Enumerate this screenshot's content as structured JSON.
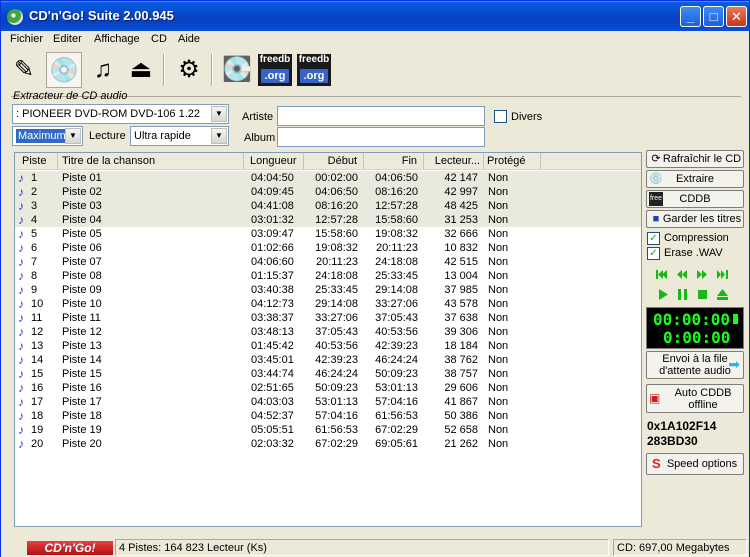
{
  "window": {
    "title": "CD'n'Go! Suite 2.00.945",
    "minimize": "_",
    "maximize": "□",
    "close": "✕"
  },
  "menu": [
    "Fichier",
    "Editer",
    "Affichage",
    "CD",
    "Aide"
  ],
  "toolbar": {
    "tools": [
      "edit-tool-icon",
      "cd-ripper-icon",
      "music-keyboard-icon",
      "cd-tray-icon",
      "settings-gear-icon",
      "cd-burner-icon"
    ],
    "freedb_top": "freedb",
    "freedb_bottom": ".org"
  },
  "extractor": {
    "group_label": "Extracteur de CD audio",
    "drive": ":  PIONEER DVD-ROM DVD-106 1.22",
    "quality": "Maximum",
    "lecture_label": "Lecture",
    "lecture_value": "Ultra rapide",
    "artist_label": "Artiste",
    "artist_value": "",
    "album_label": "Album",
    "album_value": "",
    "divers_label": "Divers"
  },
  "tracklist": {
    "columns": [
      "Piste",
      "Titre de la chanson",
      "Longueur",
      "Début",
      "Fin",
      "Lecteur...",
      "Protégé"
    ],
    "rows": [
      {
        "n": "1",
        "title": "Piste 01",
        "len": "04:04:50",
        "start": "00:02:00",
        "end": "04:06:50",
        "size": "42 147",
        "prot": "Non",
        "selected": true
      },
      {
        "n": "2",
        "title": "Piste 02",
        "len": "04:09:45",
        "start": "04:06:50",
        "end": "08:16:20",
        "size": "42 997",
        "prot": "Non",
        "selected": true
      },
      {
        "n": "3",
        "title": "Piste 03",
        "len": "04:41:08",
        "start": "08:16:20",
        "end": "12:57:28",
        "size": "48 425",
        "prot": "Non",
        "selected": true
      },
      {
        "n": "4",
        "title": "Piste 04",
        "len": "03:01:32",
        "start": "12:57:28",
        "end": "15:58:60",
        "size": "31 253",
        "prot": "Non",
        "selected": true
      },
      {
        "n": "5",
        "title": "Piste 05",
        "len": "03:09:47",
        "start": "15:58:60",
        "end": "19:08:32",
        "size": "32 666",
        "prot": "Non",
        "selected": false
      },
      {
        "n": "6",
        "title": "Piste 06",
        "len": "01:02:66",
        "start": "19:08:32",
        "end": "20:11:23",
        "size": "10 832",
        "prot": "Non",
        "selected": false
      },
      {
        "n": "7",
        "title": "Piste 07",
        "len": "04:06:60",
        "start": "20:11:23",
        "end": "24:18:08",
        "size": "42 515",
        "prot": "Non",
        "selected": false
      },
      {
        "n": "8",
        "title": "Piste 08",
        "len": "01:15:37",
        "start": "24:18:08",
        "end": "25:33:45",
        "size": "13 004",
        "prot": "Non",
        "selected": false
      },
      {
        "n": "9",
        "title": "Piste 09",
        "len": "03:40:38",
        "start": "25:33:45",
        "end": "29:14:08",
        "size": "37 985",
        "prot": "Non",
        "selected": false
      },
      {
        "n": "10",
        "title": "Piste 10",
        "len": "04:12:73",
        "start": "29:14:08",
        "end": "33:27:06",
        "size": "43 578",
        "prot": "Non",
        "selected": false
      },
      {
        "n": "11",
        "title": "Piste 11",
        "len": "03:38:37",
        "start": "33:27:06",
        "end": "37:05:43",
        "size": "37 638",
        "prot": "Non",
        "selected": false
      },
      {
        "n": "12",
        "title": "Piste 12",
        "len": "03:48:13",
        "start": "37:05:43",
        "end": "40:53:56",
        "size": "39 306",
        "prot": "Non",
        "selected": false
      },
      {
        "n": "13",
        "title": "Piste 13",
        "len": "01:45:42",
        "start": "40:53:56",
        "end": "42:39:23",
        "size": "18 184",
        "prot": "Non",
        "selected": false
      },
      {
        "n": "14",
        "title": "Piste 14",
        "len": "03:45:01",
        "start": "42:39:23",
        "end": "46:24:24",
        "size": "38 762",
        "prot": "Non",
        "selected": false
      },
      {
        "n": "15",
        "title": "Piste 15",
        "len": "03:44:74",
        "start": "46:24:24",
        "end": "50:09:23",
        "size": "38 757",
        "prot": "Non",
        "selected": false
      },
      {
        "n": "16",
        "title": "Piste 16",
        "len": "02:51:65",
        "start": "50:09:23",
        "end": "53:01:13",
        "size": "29 606",
        "prot": "Non",
        "selected": false
      },
      {
        "n": "17",
        "title": "Piste 17",
        "len": "04:03:03",
        "start": "53:01:13",
        "end": "57:04:16",
        "size": "41 867",
        "prot": "Non",
        "selected": false
      },
      {
        "n": "18",
        "title": "Piste 18",
        "len": "04:52:37",
        "start": "57:04:16",
        "end": "61:56:53",
        "size": "50 386",
        "prot": "Non",
        "selected": false
      },
      {
        "n": "19",
        "title": "Piste 19",
        "len": "05:05:51",
        "start": "61:56:53",
        "end": "67:02:29",
        "size": "52 658",
        "prot": "Non",
        "selected": false
      },
      {
        "n": "20",
        "title": "Piste 20",
        "len": "02:03:32",
        "start": "67:02:29",
        "end": "69:05:61",
        "size": "21 262",
        "prot": "Non",
        "selected": false
      }
    ]
  },
  "panel": {
    "refresh": "Rafraîchir le CD",
    "extract": "Extraire",
    "cddb": "CDDB",
    "keep_titles": "Garder les titres",
    "compression": "Compression",
    "erase_wav": "Erase .WAV",
    "lcd_top": "00:00:00",
    "lcd_bottom": "0:00:00",
    "send_queue_line1": "Envoi à la file",
    "send_queue_line2": "d'attente audio",
    "auto_cddb_line1": "Auto CDDB",
    "auto_cddb_line2": "offline",
    "disc_id_1": "0x1A102F14",
    "disc_id_2": "283BD30",
    "speed_options": "Speed options"
  },
  "status": {
    "logo": "CD'n'Go!",
    "summary": "4 Pistes: 164 823 Lecteur (Ks)",
    "capacity": "CD: 697,00 Megabytes"
  },
  "colors": {
    "title_bar": "#0a5fe4",
    "selection_highlight": "#eae9dd",
    "lcd_text": "#17ff17",
    "logo_red": "#e84040"
  }
}
